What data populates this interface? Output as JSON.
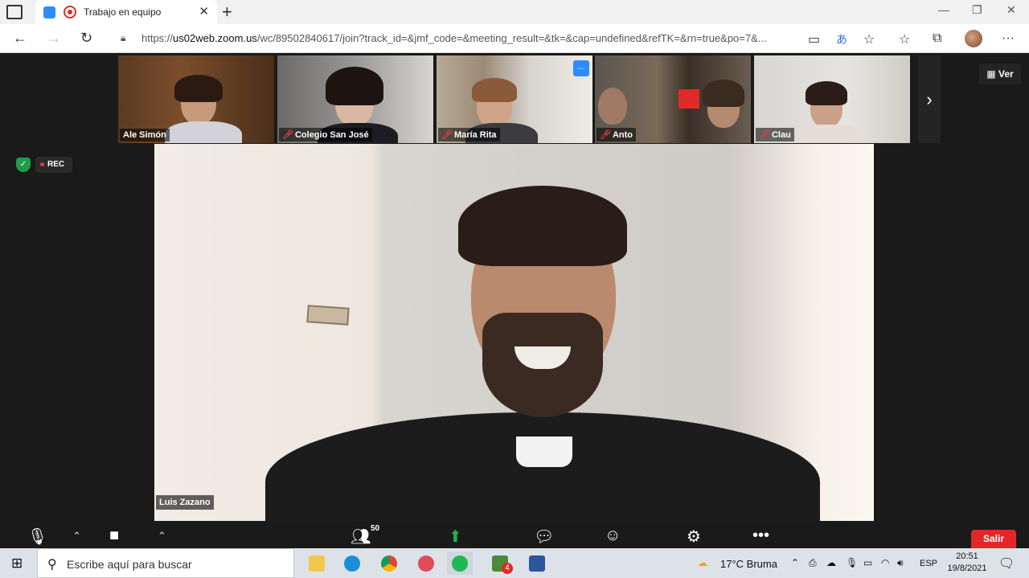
{
  "browser": {
    "tab_title": "Trabajo en equipo",
    "url_host": "us02web.zoom.us",
    "url_scheme": "https://",
    "url_path": "/wc/89502840617/join?track_id=&jmf_code=&meeting_result=&tk=&cap=undefined&refTK=&rn=true&po=7&..."
  },
  "gallery": {
    "participants": [
      {
        "name": "Ale Simón",
        "muted": false
      },
      {
        "name": "Colegio San José",
        "muted": true
      },
      {
        "name": "María Rita",
        "muted": true
      },
      {
        "name": "Anto",
        "muted": true
      },
      {
        "name": "Clau",
        "muted": true
      }
    ],
    "more_label": "...",
    "view_label": "Ver"
  },
  "meeting": {
    "rec_label": "REC",
    "speaker_name": "Luis Zazano",
    "participant_count": "50",
    "leave_label": "Salir"
  },
  "taskbar": {
    "search_placeholder": "Escribe aquí para buscar",
    "weather": "17°C  Bruma",
    "lang": "ESP",
    "time": "20:51",
    "date": "19/8/2021",
    "badge": "4"
  },
  "colors": {
    "zoom_blue": "#2d8cff",
    "leave_red": "#e02828",
    "secure_green": "#1f9d4a",
    "share_green": "#1fb14a"
  }
}
